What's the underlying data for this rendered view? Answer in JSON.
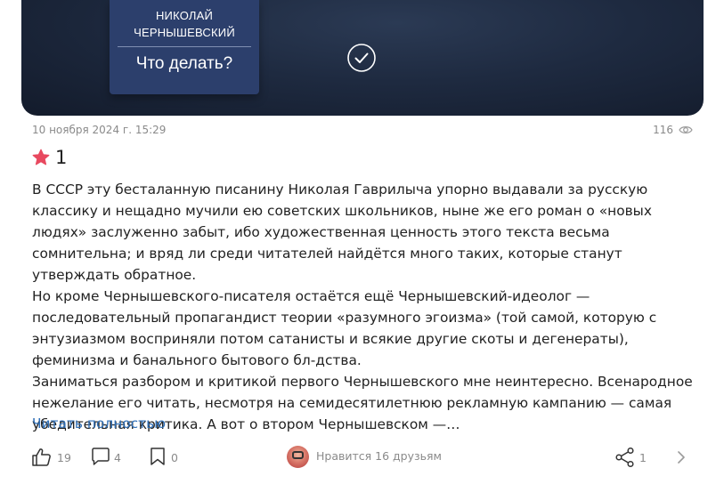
{
  "book": {
    "author_line1": "НИКОЛАЙ",
    "author_line2": "ЧЕРНЫШЕВСКИЙ",
    "title": "Что делать?"
  },
  "meta": {
    "date": "10 ноября 2024 г. 15:29",
    "views": "116"
  },
  "rating": {
    "value": "1",
    "color": "#e8495f"
  },
  "review": {
    "paragraphs": [
      "В СССР эту бесталанную писанину Николая Гаврилыча упорно выдавали за русскую классику и нещадно мучили ею советских школьников, ныне же его роман о «новых людях» заслуженно забыт, ибо художественная ценность этого текста весьма сомнительна; и вряд ли среди читателей найдётся много таких, которые станут утверждать обратное.",
      "Но кроме Чернышевского-писателя остаётся ещё Чернышевский-идеолог — последовательный пропагандист теории «разумного эгоизма» (той самой, которую с энтузиазмом восприняли потом сатанисты и всякие другие скоты и дегенераты), феминизма и банального бытового бл-дства.",
      "Заниматься разбором и критикой первого Чернышевского мне неинтересно. Всенародное нежелание его читать, несмотря на семидесятилетнюю рекламную кампанию — самая убедительная критика. А вот о втором Чернышевском —…"
    ],
    "read_more": "Читать полностью",
    "link_color": "#2f6fb7"
  },
  "actions": {
    "likes": "19",
    "comments": "4",
    "bookmarks": "0",
    "friends_text": "Нравится 16 друзьям",
    "shares": "1"
  },
  "icons": {
    "check": "check-circle-icon",
    "eye": "eye-icon",
    "star": "star-icon",
    "like": "thumbs-up-icon",
    "comment": "comment-icon",
    "bookmark": "bookmark-icon",
    "share": "share-icon",
    "chevron": "chevron-right-icon"
  }
}
